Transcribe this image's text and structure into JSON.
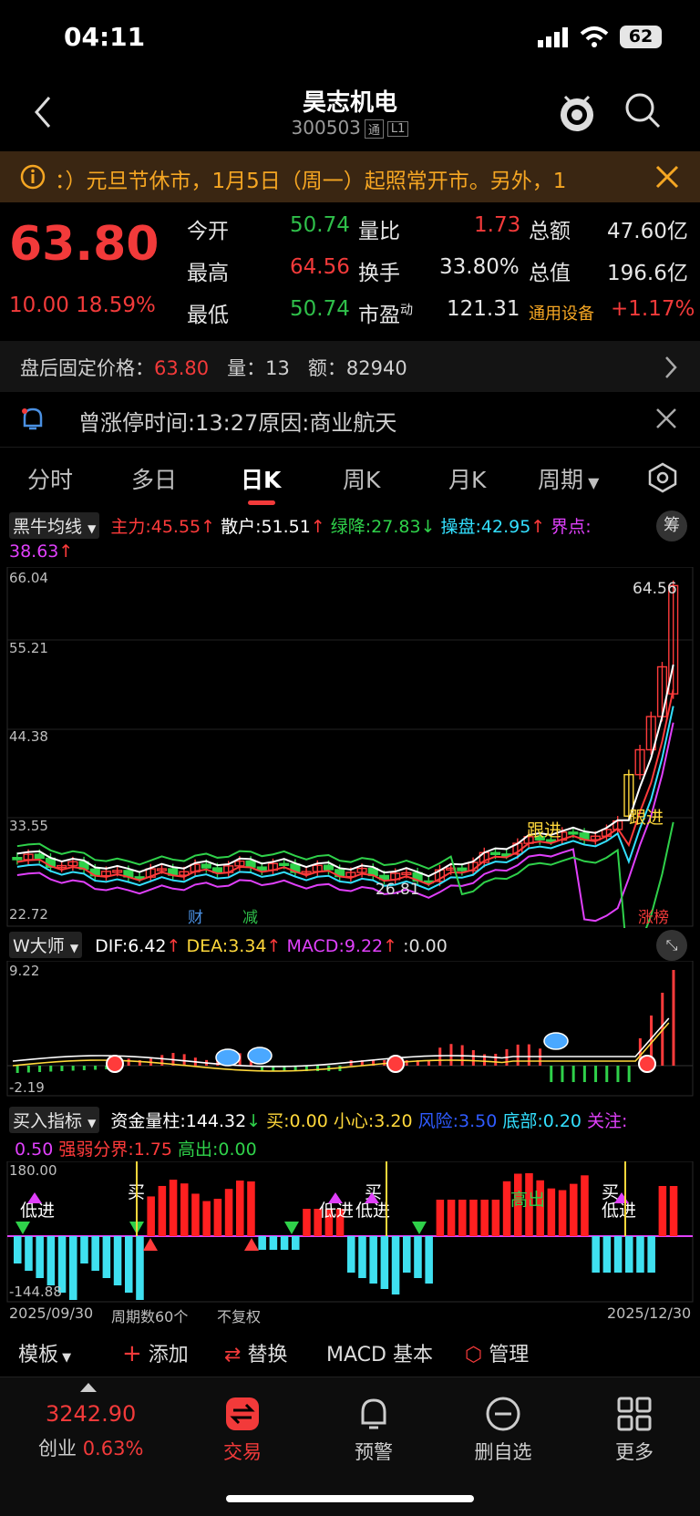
{
  "status": {
    "time": "04:11",
    "battery": "62"
  },
  "header": {
    "title": "昊志机电",
    "code": "300503",
    "tag1": "通",
    "tag2": "L1"
  },
  "notice": {
    "text": "：）元旦节休市，1月5日（周一）起照常开市。另外，1"
  },
  "quote": {
    "price": "63.80",
    "change": "10.00",
    "change_pct": "18.59%",
    "rows": [
      {
        "l1": "今开",
        "v1": "50.74",
        "l2": "量比",
        "v2": "1.73",
        "l3": "总额",
        "v3": "47.60亿"
      },
      {
        "l1": "最高",
        "v1": "64.56",
        "l2": "换手",
        "v2": "33.80%",
        "l3": "总值",
        "v3": "196.6亿"
      },
      {
        "l1": "最低",
        "v1": "50.74",
        "l2": "市盈",
        "v2": "121.31",
        "l3": "通用设备",
        "v3": "+1.17%"
      }
    ],
    "pe_sup": "动"
  },
  "after_hours": {
    "label": "盘后固定价格：",
    "price": "63.80",
    "vol_label": "量：",
    "vol": "13",
    "amt_label": "额：",
    "amt": "82940"
  },
  "limit_info": {
    "text": "曾涨停时间:13:27原因:商业航天"
  },
  "tabs": [
    "分时",
    "多日",
    "日K",
    "周K",
    "月K",
    "周期"
  ],
  "main_indicator": {
    "name": "黑牛均线",
    "items": [
      {
        "label": "主力:45.55",
        "color": "#ff3b3b"
      },
      {
        "label": "散户:51.51",
        "color": "#ffffff"
      },
      {
        "label": "绿降:27.83",
        "color": "#2fd14a"
      },
      {
        "label": "操盘:42.95",
        "color": "#33e0ff"
      },
      {
        "label": "界点:",
        "color": "#e040fb"
      }
    ],
    "jiedian": "38.63",
    "chip_btn": "筹"
  },
  "kchart": {
    "y_labels": [
      "66.04",
      "55.21",
      "44.38",
      "33.55",
      "22.72"
    ],
    "high_label": "64.56",
    "low_label": "26.81",
    "event1": "财",
    "event2": "减",
    "event3": "涨榜",
    "tag_follow": "跟进"
  },
  "macd_indicator": {
    "name": "W大师",
    "dif": "DIF:6.42",
    "dea": "DEA:3.34",
    "macd": "MACD:9.22",
    "zero": ":0.00",
    "y_top": "9.22",
    "y_bottom": "-2.19"
  },
  "buy_indicator": {
    "name": "买入指标",
    "items": [
      {
        "label": "资金量柱:144.32",
        "color": "#ffffff"
      },
      {
        "label": "买:0.00",
        "color": "#ffd83b"
      },
      {
        "label": "小心:3.20",
        "color": "#ffd83b"
      },
      {
        "label": "风险:3.50",
        "color": "#2f5bff"
      },
      {
        "label": "底部:0.20",
        "color": "#33e0ff"
      },
      {
        "label": "关注:",
        "color": "#e040fb"
      }
    ],
    "line2": [
      {
        "label": "0.50",
        "color": "#e040fb"
      },
      {
        "label": "强弱分界:1.75",
        "color": "#ff3b3b"
      },
      {
        "label": "高出:0.00",
        "color": "#2fd14a"
      }
    ],
    "y_top": "180.00",
    "y_bottom": "-144.88",
    "tag_low": "低进",
    "tag_buy": "买",
    "tag_high": "高出"
  },
  "axis": {
    "start": "2025/09/30",
    "periods": "周期数60个",
    "adjust": "不复权",
    "end": "2025/12/30"
  },
  "toolbar": {
    "template": "模板",
    "add": "添加",
    "replace": "替换",
    "basic": "MACD 基本",
    "manage": "管理"
  },
  "bottom_nav": {
    "index_value": "3242.90",
    "index_name": "创业",
    "index_pct": "0.63%",
    "items": [
      "交易",
      "预警",
      "删自选",
      "更多"
    ]
  },
  "colors": {
    "up": "#f23a3a",
    "down": "#2fbf4a",
    "accent": "#ff3b3b",
    "notice_bg": "#3a2612",
    "notice_text": "#f5a623"
  }
}
